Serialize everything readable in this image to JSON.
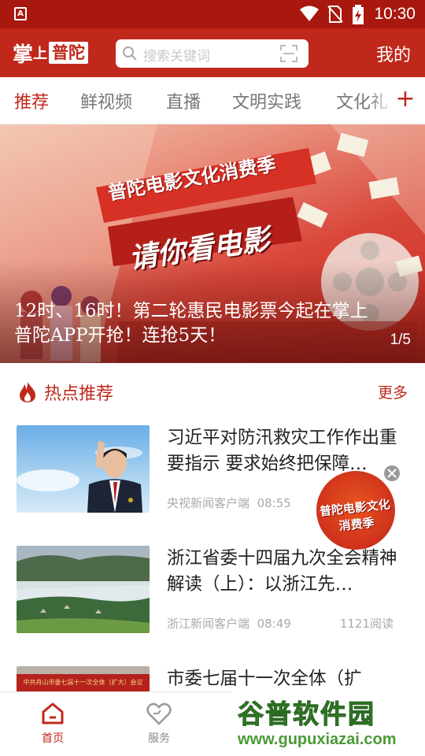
{
  "status_bar": {
    "time": "10:30",
    "app_indicator": "A"
  },
  "header": {
    "logo": {
      "part1": "掌",
      "part2": "上",
      "part3": "普陀"
    },
    "search_placeholder": "搜索关键词",
    "mine_label": "我的"
  },
  "tabs": {
    "items": [
      {
        "label": "推荐",
        "active": true
      },
      {
        "label": "鲜视频",
        "active": false
      },
      {
        "label": "直播",
        "active": false
      },
      {
        "label": "文明实践",
        "active": false
      },
      {
        "label": "文化礼",
        "active": false
      }
    ],
    "add_label": "+"
  },
  "banner": {
    "poster_line1": "普陀电影文化消费季",
    "poster_line2": "请你看电影",
    "headline": "12时、16时！第二轮惠民电影票今起在掌上普陀APP开抢！连抢5天！",
    "pager": "1/5"
  },
  "section": {
    "title": "热点推荐",
    "more": "更多"
  },
  "news": [
    {
      "title": "习近平对防汛救灾工作作出重要指示 要求始终把保障…",
      "source": "央视新闻客户端",
      "time": "08:55",
      "reads": ""
    },
    {
      "title": "浙江省委十四届九次全会精神解读（上）：以浙江先…",
      "source": "浙江新闻客户端",
      "time": "08:49",
      "reads": "1121阅读"
    },
    {
      "title": "市委七届十一次全体（扩",
      "source": "",
      "time": "",
      "reads": "",
      "thumb_caption": "中共舟山市委七届十一次全体（扩大）会议"
    }
  ],
  "float_ad": {
    "text": "普陀电影文化消费季"
  },
  "bottom_nav": [
    {
      "label": "首页",
      "icon": "home-icon",
      "active": true
    },
    {
      "label": "服务",
      "icon": "heart-icon",
      "active": false
    },
    {
      "label": "",
      "icon": "partial-icon",
      "active": false
    }
  ],
  "watermark": {
    "top": "谷普软件园",
    "bottom": "www.gupuxiazai.com"
  },
  "colors": {
    "brand_red": "#c0281c",
    "status_red": "#a8180f"
  }
}
